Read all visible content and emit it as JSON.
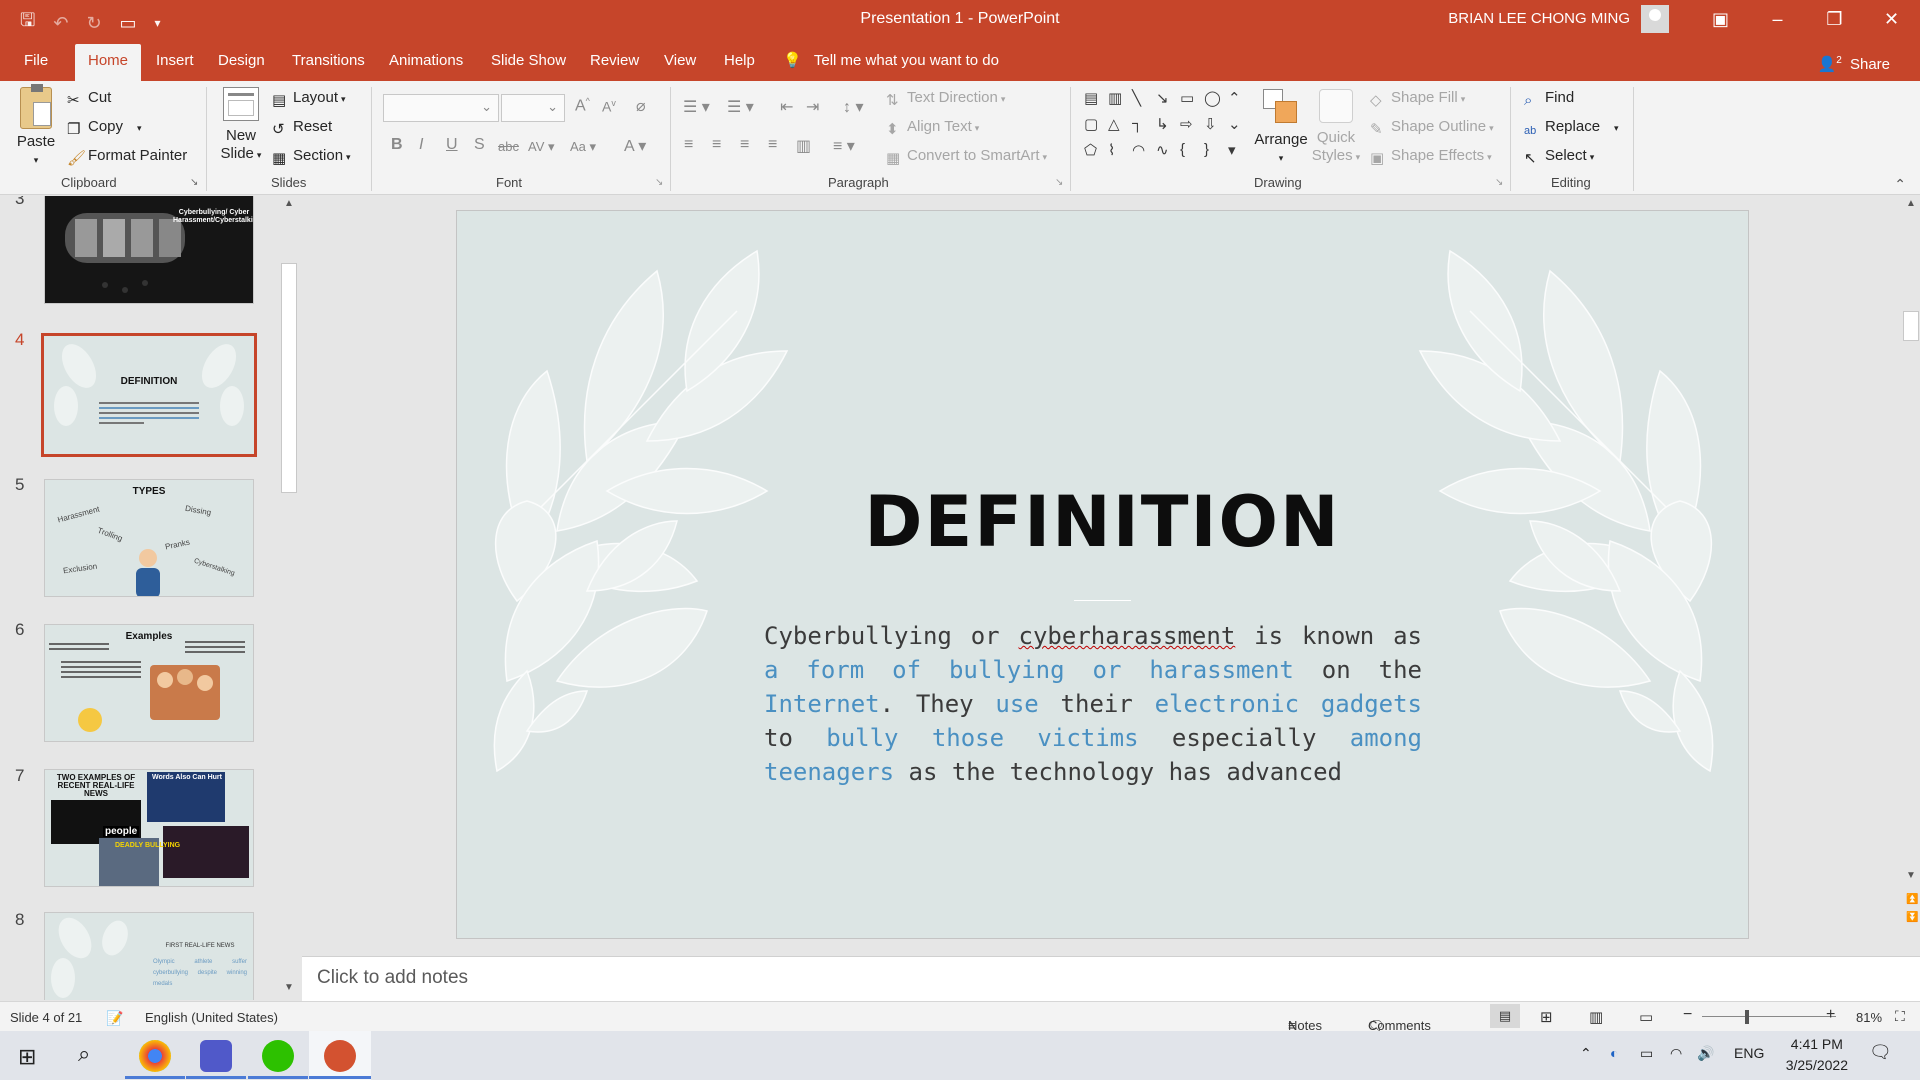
{
  "titlebar": {
    "doc_title": "Presentation 1  -  PowerPoint",
    "user_name": "BRIAN LEE CHONG MING"
  },
  "tabs": [
    "File",
    "Home",
    "Insert",
    "Design",
    "Transitions",
    "Animations",
    "Slide Show",
    "Review",
    "View",
    "Help"
  ],
  "tell_me": "Tell me what you want to do",
  "share": "Share",
  "ribbon": {
    "clipboard": {
      "paste": "Paste",
      "cut": "Cut",
      "copy": "Copy",
      "format_painter": "Format Painter",
      "label": "Clipboard"
    },
    "slides": {
      "new_slide": "New Slide",
      "layout": "Layout",
      "reset": "Reset",
      "section": "Section",
      "label": "Slides"
    },
    "font": {
      "label": "Font",
      "font_name": "",
      "font_size": ""
    },
    "paragraph": {
      "text_direction": "Text Direction",
      "align_text": "Align Text",
      "convert_smartart": "Convert to SmartArt",
      "label": "Paragraph"
    },
    "drawing": {
      "arrange": "Arrange",
      "quick_styles": "Quick Styles",
      "shape_fill": "Shape Fill",
      "shape_outline": "Shape Outline",
      "shape_effects": "Shape Effects",
      "label": "Drawing"
    },
    "editing": {
      "find": "Find",
      "replace": "Replace",
      "select": "Select",
      "label": "Editing"
    }
  },
  "thumbnails": [
    {
      "num": "3",
      "title": "Cyberbullying/ Cyber Harassment/Cyberstalking"
    },
    {
      "num": "4",
      "title": "DEFINITION"
    },
    {
      "num": "5",
      "title": "TYPES",
      "words": [
        "Harassment",
        "Dissing",
        "Trolling",
        "Pranks",
        "Exclusion",
        "Cyberstalking"
      ]
    },
    {
      "num": "6",
      "title": "Examples"
    },
    {
      "num": "7",
      "title": "TWO EXAMPLES OF RECENT REAL-LIFE NEWS",
      "caption": "Words Also Can Hurt",
      "badge": "people",
      "badge2": "DEADLY BULLYING"
    },
    {
      "num": "8",
      "title": "FIRST REAL-LIFE NEWS",
      "body": "Olympic athlete suffer cyberbullying despite winning medals"
    }
  ],
  "slide": {
    "title": "DEFINITION",
    "body": {
      "s1": "Cyberbullying or ",
      "s2": "cyberharassment",
      "s3": " is known as ",
      "s4": "a form of bullying or harassment",
      "s5": " on the ",
      "s6": "Internet",
      "s7": ". They ",
      "s8": "use",
      "s9": " their ",
      "s10": "electronic gadgets",
      "s11": " to ",
      "s12": "bully those victims",
      "s13": " especially ",
      "s14": "among teenagers",
      "s15": " as the technology has advanced"
    }
  },
  "notes_placeholder": "Click to add notes",
  "status": {
    "slide_info": "Slide 4 of 21",
    "language": "English (United States)",
    "notes": "Notes",
    "comments": "Comments",
    "zoom": "81%"
  },
  "taskbar": {
    "time": "4:41 PM",
    "date": "3/25/2022",
    "lang": "ENG"
  },
  "colors": {
    "accent": "#c6452a",
    "slide_bg": "#dce5e4",
    "link_blue": "#4a90c2"
  }
}
